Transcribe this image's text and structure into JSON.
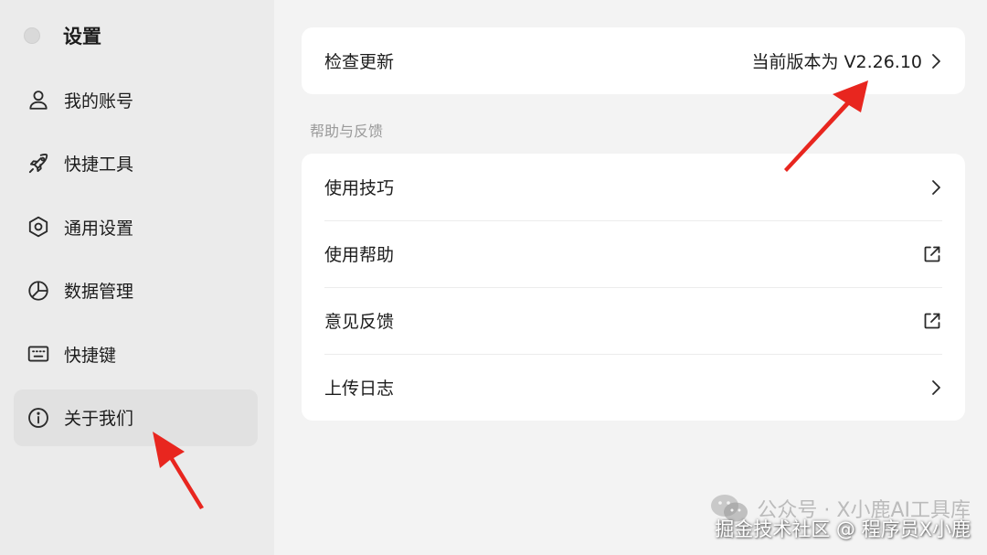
{
  "sidebar": {
    "title": "设置",
    "items": [
      {
        "label": "我的账号",
        "icon": "user-icon"
      },
      {
        "label": "快捷工具",
        "icon": "rocket-icon"
      },
      {
        "label": "通用设置",
        "icon": "hexagon-settings-icon"
      },
      {
        "label": "数据管理",
        "icon": "pie-chart-icon"
      },
      {
        "label": "快捷键",
        "icon": "keyboard-icon"
      },
      {
        "label": "关于我们",
        "icon": "info-icon",
        "active": true
      }
    ]
  },
  "main": {
    "update_row": {
      "label": "检查更新",
      "value": "当前版本为 V2.26.10"
    },
    "help_section": {
      "title": "帮助与反馈",
      "rows": [
        {
          "label": "使用技巧",
          "icon": "chevron-right-icon"
        },
        {
          "label": "使用帮助",
          "icon": "external-link-icon"
        },
        {
          "label": "意见反馈",
          "icon": "external-link-icon"
        },
        {
          "label": "上传日志",
          "icon": "chevron-right-icon"
        }
      ]
    }
  },
  "watermark": {
    "top": "公众号 · X小鹿AI工具库",
    "bottom": "掘金技术社区 @ 程序员X小鹿"
  },
  "colors": {
    "annotation_arrow": "#e8261f",
    "active_item_bg": "#e1e1e1",
    "sidebar_bg": "#ebebeb",
    "content_bg": "#f3f3f3"
  }
}
